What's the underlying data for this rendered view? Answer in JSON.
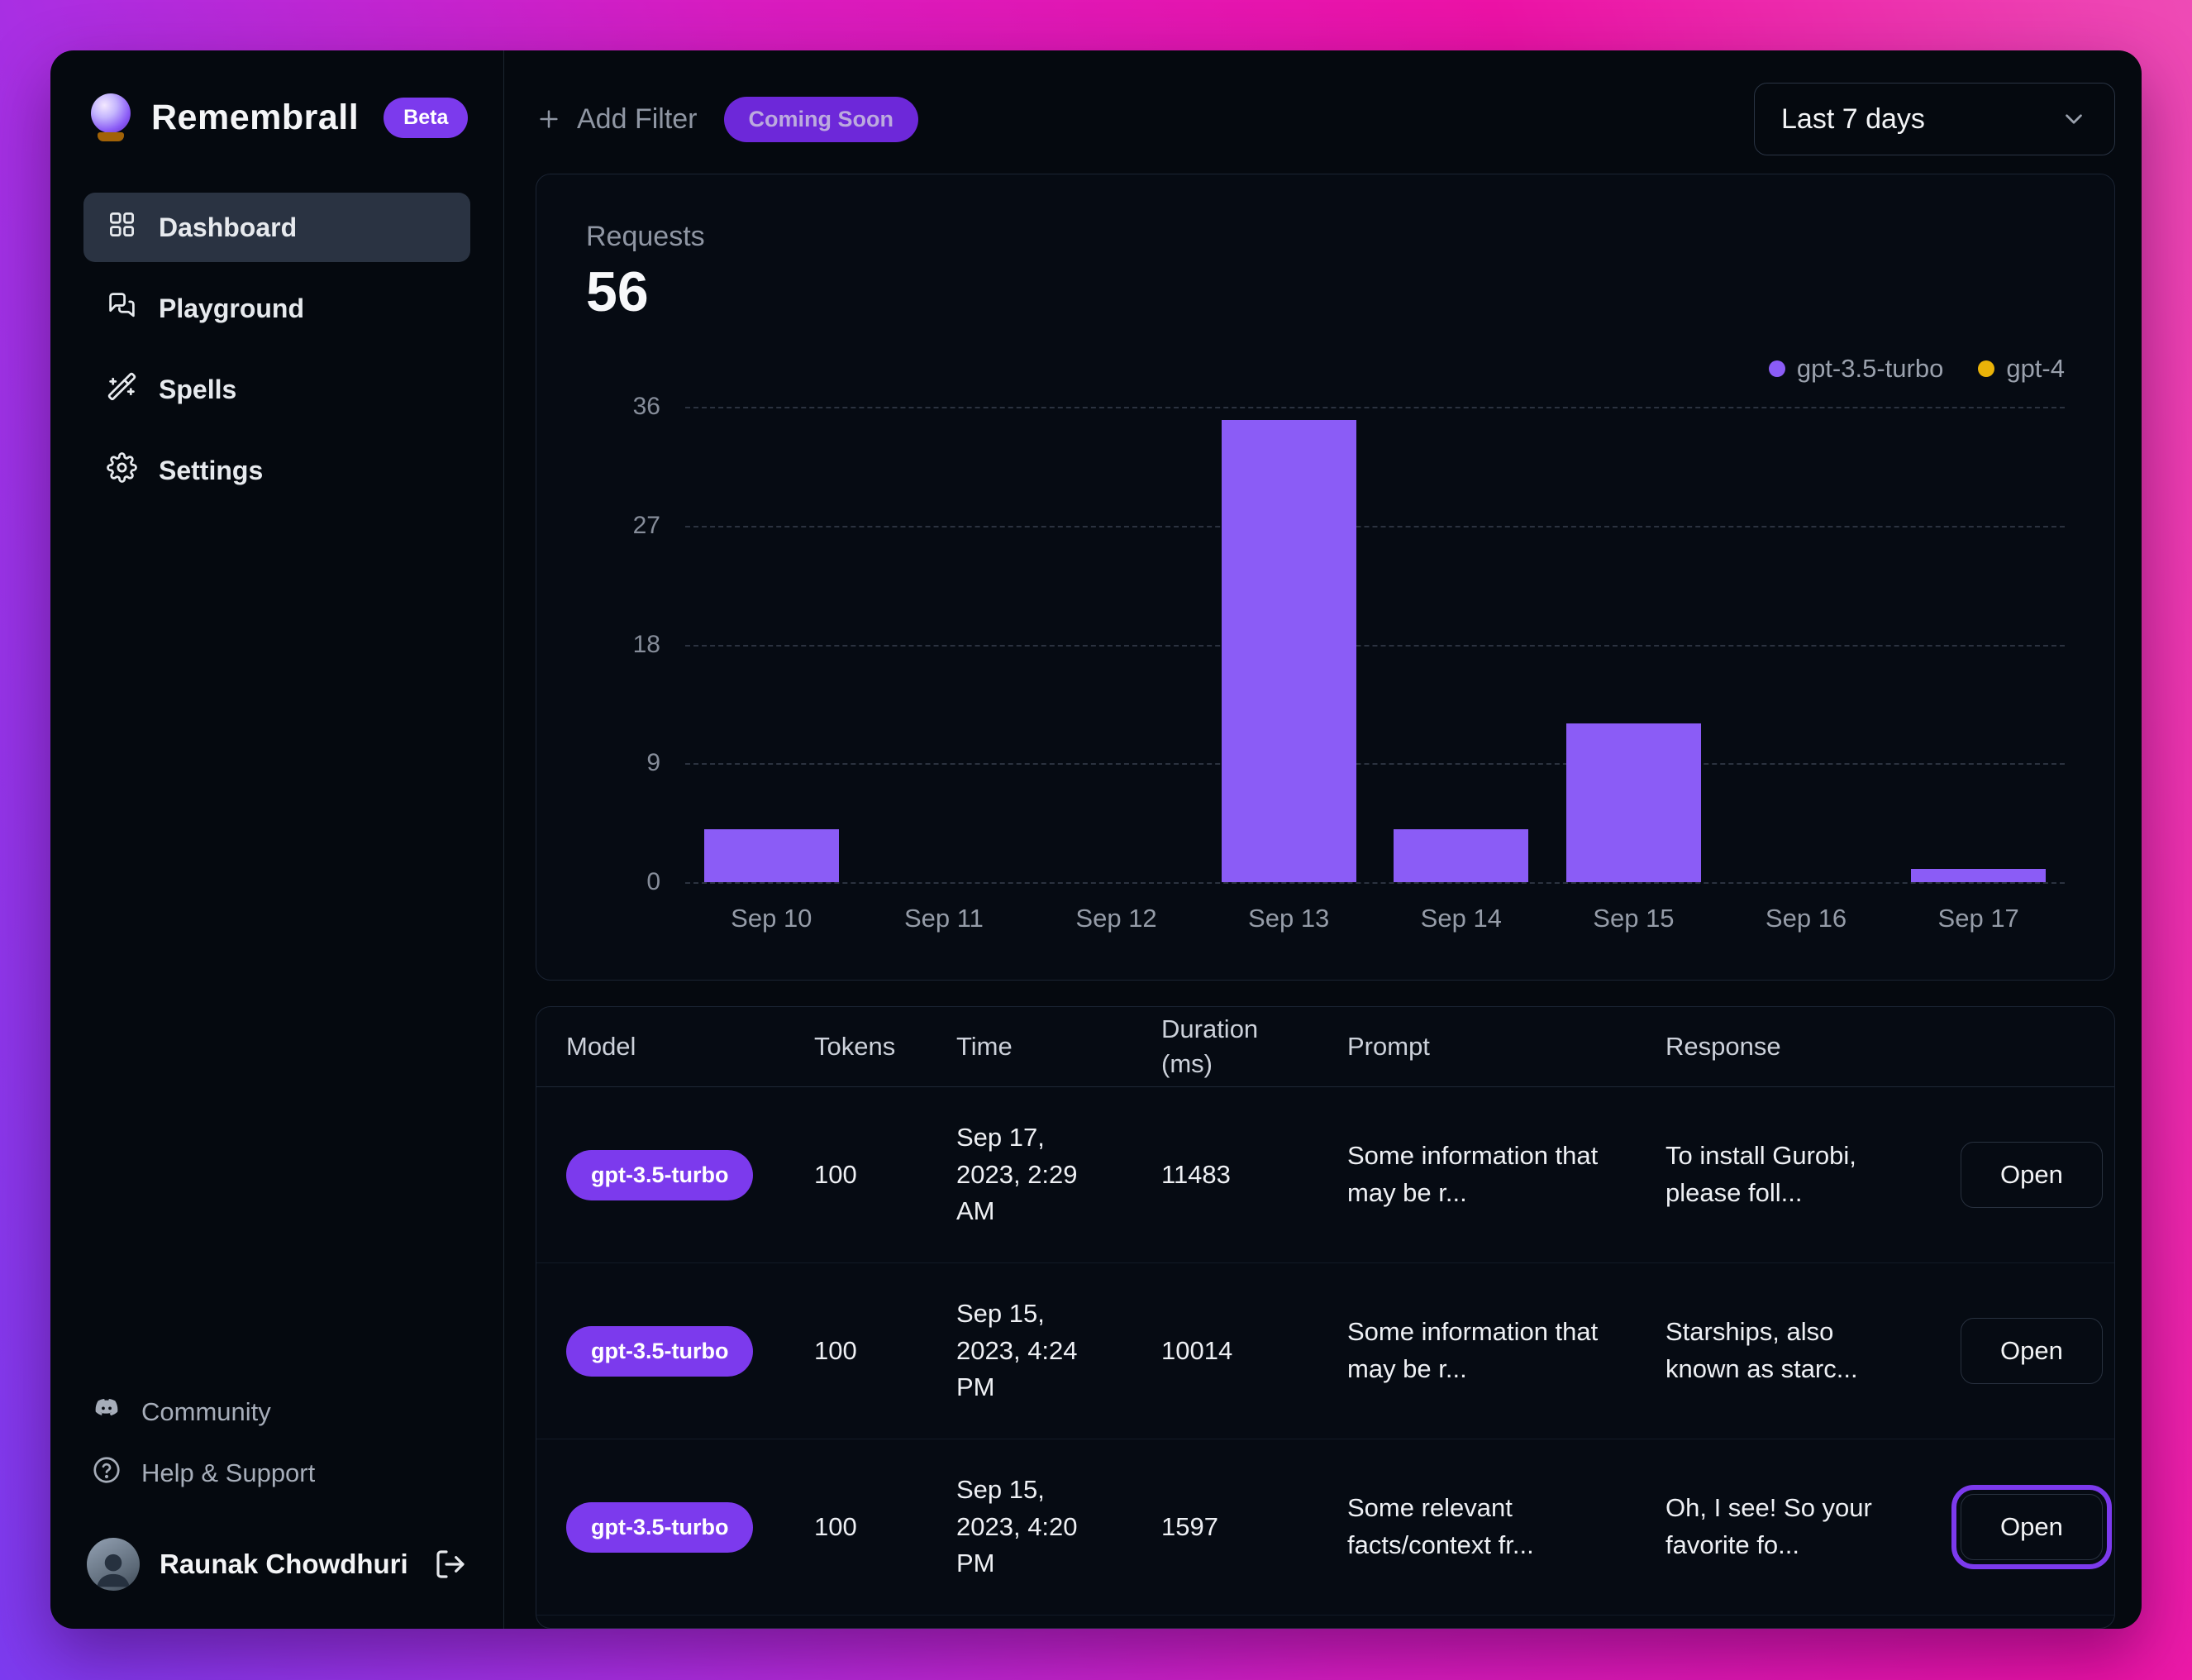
{
  "app": {
    "name": "Remembrall",
    "beta_label": "Beta"
  },
  "sidebar": {
    "nav_items": [
      {
        "label": "Dashboard",
        "icon": "dashboard-grid-icon",
        "active": true
      },
      {
        "label": "Playground",
        "icon": "chat-bubbles-icon",
        "active": false
      },
      {
        "label": "Spells",
        "icon": "magic-wand-icon",
        "active": false
      },
      {
        "label": "Settings",
        "icon": "gear-icon",
        "active": false
      }
    ],
    "footer_items": [
      {
        "label": "Community",
        "icon": "discord-icon"
      },
      {
        "label": "Help & Support",
        "icon": "help-circle-icon"
      }
    ],
    "user": {
      "name": "Raunak Chowdhuri"
    }
  },
  "topbar": {
    "add_filter_label": "Add Filter",
    "coming_soon_label": "Coming Soon",
    "date_range_value": "Last 7 days"
  },
  "metrics": {
    "requests_label": "Requests",
    "requests_value": "56"
  },
  "chart_data": {
    "type": "bar",
    "title": "Requests",
    "categories": [
      "Sep 10",
      "Sep 11",
      "Sep 12",
      "Sep 13",
      "Sep 14",
      "Sep 15",
      "Sep 16",
      "Sep 17"
    ],
    "series": [
      {
        "name": "gpt-3.5-turbo",
        "color": "#8b5cf6",
        "values": [
          4,
          0,
          0,
          35,
          4,
          12,
          0,
          1
        ]
      },
      {
        "name": "gpt-4",
        "color": "#eab308",
        "values": [
          0,
          0,
          0,
          0,
          0,
          0,
          0,
          0
        ]
      }
    ],
    "ylim": [
      0,
      36
    ],
    "yticks": [
      0,
      9,
      18,
      27,
      36
    ],
    "grid": "horizontal-dashed",
    "legend_position": "top-right"
  },
  "table": {
    "columns": [
      "Model",
      "Tokens",
      "Time",
      "Duration (ms)",
      "Prompt",
      "Response"
    ],
    "open_button_label": "Open",
    "rows": [
      {
        "model": "gpt-3.5-turbo",
        "tokens": "100",
        "time": "Sep 17, 2023, 2:29 AM",
        "duration": "11483",
        "prompt": "Some information that may be r...",
        "response": "To install Gurobi, please foll...",
        "open_highlighted": false
      },
      {
        "model": "gpt-3.5-turbo",
        "tokens": "100",
        "time": "Sep 15, 2023, 4:24 PM",
        "duration": "10014",
        "prompt": "Some information that may be r...",
        "response": "Starships, also known as starc...",
        "open_highlighted": false
      },
      {
        "model": "gpt-3.5-turbo",
        "tokens": "100",
        "time": "Sep 15, 2023, 4:20 PM",
        "duration": "1597",
        "prompt": "Some relevant facts/context fr...",
        "response": "Oh, I see! So your favorite fo...",
        "open_highlighted": true
      }
    ]
  },
  "colors": {
    "accent": "#7c3aed",
    "bar_purple": "#8b5cf6",
    "legend_yellow": "#eab308"
  }
}
